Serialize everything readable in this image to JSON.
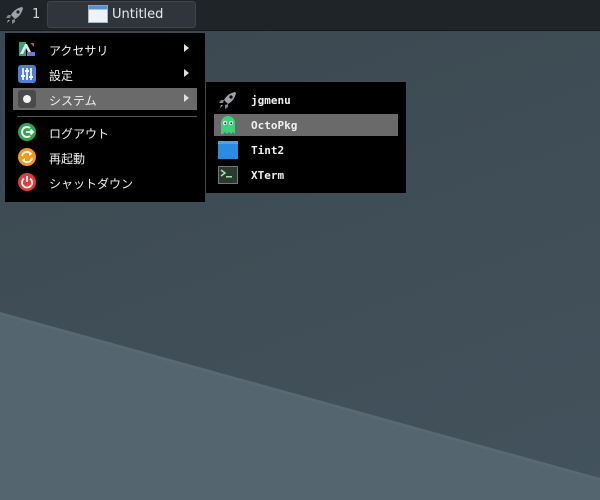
{
  "taskbar": {
    "launcher_icon": "rocket-icon",
    "workspace": "1",
    "task": {
      "icon": "window-icon",
      "title": "Untitled"
    }
  },
  "menu": {
    "items": [
      {
        "label": "アクセサリ",
        "icon": "accessories-icon",
        "has_submenu": true
      },
      {
        "label": "設定",
        "icon": "settings-icon",
        "has_submenu": true
      },
      {
        "label": "システム",
        "icon": "system-icon",
        "has_submenu": true,
        "selected": true
      },
      {
        "label": "ログアウト",
        "icon": "logout-icon",
        "has_submenu": false
      },
      {
        "label": "再起動",
        "icon": "reboot-icon",
        "has_submenu": false
      },
      {
        "label": "シャットダウン",
        "icon": "power-icon",
        "has_submenu": false
      }
    ]
  },
  "submenu": {
    "items": [
      {
        "label": "jgmenu",
        "icon": "rocket-icon"
      },
      {
        "label": "OctoPkg",
        "icon": "octopkg-icon",
        "selected": true
      },
      {
        "label": "Tint2",
        "icon": "tint2-icon"
      },
      {
        "label": "XTerm",
        "icon": "terminal-icon"
      }
    ]
  },
  "colors": {
    "menu_bg": "#000000",
    "menu_selected": "#6a6a6a",
    "taskbar_bg": "#1e2428",
    "desktop_dark": "#3f4d56",
    "desktop_light": "#4f6270"
  }
}
